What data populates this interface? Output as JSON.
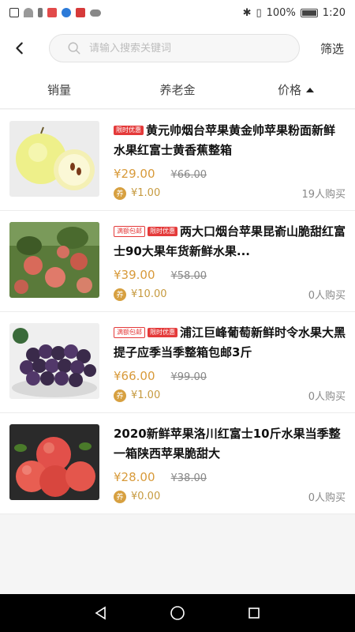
{
  "status_bar": {
    "battery": "100%",
    "time": "1:20"
  },
  "header": {
    "search_placeholder": "请输入搜索关键词",
    "filter_label": "筛选"
  },
  "sort_tabs": [
    {
      "label": "销量"
    },
    {
      "label": "养老金"
    },
    {
      "label": "价格"
    }
  ],
  "products": [
    {
      "tags": [
        "限时优惠"
      ],
      "title": "黄元帅烟台苹果黄金帅苹果粉面新鲜水果红富士黄香蕉整箱",
      "price": "¥29.00",
      "old_price": "¥66.00",
      "pension": "¥1.00",
      "buyers": "19人购买",
      "image": "yellow-apples"
    },
    {
      "tags": [
        "满额包邮",
        "限时优惠"
      ],
      "title": "两大口烟台苹果昆嵛山脆甜红富士90大果年货新鲜水果...",
      "price": "¥39.00",
      "old_price": "¥58.00",
      "pension": "¥10.00",
      "buyers": "0人购买",
      "image": "apple-tree"
    },
    {
      "tags": [
        "满额包邮",
        "限时优惠"
      ],
      "title": "浦江巨峰葡萄新鲜时令水果大黑提子应季当季整箱包邮3斤",
      "price": "¥66.00",
      "old_price": "¥99.00",
      "pension": "¥1.00",
      "buyers": "0人购买",
      "image": "grapes"
    },
    {
      "tags": [],
      "title": "2020新鲜苹果洛川红富士10斤水果当季整一箱陕西苹果脆甜大",
      "price": "¥28.00",
      "old_price": "¥38.00",
      "pension": "¥0.00",
      "buyers": "0人购买",
      "image": "red-apples"
    }
  ],
  "pension_badge": "养",
  "colors": {
    "price": "#d89a3a",
    "tag": "#e43a3a",
    "pension": "#c69a3f"
  }
}
